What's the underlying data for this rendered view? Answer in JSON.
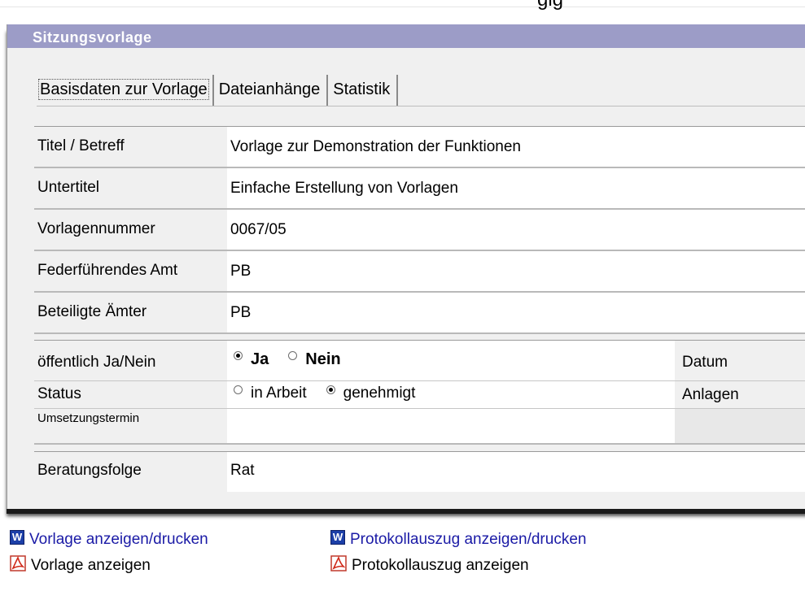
{
  "top_fragment": "gig",
  "panel": {
    "title": "Sitzungsvorlage",
    "tabs": [
      {
        "label": "Basisdaten zur Vorlage",
        "active": true
      },
      {
        "label": "Dateianhänge",
        "active": false
      },
      {
        "label": "Statistik",
        "active": false
      }
    ]
  },
  "form": {
    "rows": [
      {
        "label": "Titel / Betreff",
        "value": "Vorlage zur Demonstration der Funktionen"
      },
      {
        "label": "Untertitel",
        "value": "Einfache Erstellung von Vorlagen"
      },
      {
        "label": "Vorlagennummer",
        "value": "0067/05"
      },
      {
        "label": "Federführendes Amt",
        "value": "PB"
      },
      {
        "label": "Beteiligte Ämter",
        "value": "PB"
      }
    ],
    "oeffentlich": {
      "label": "öffentlich Ja/Nein",
      "options": [
        {
          "label": "Ja",
          "checked": true
        },
        {
          "label": "Nein",
          "checked": false
        }
      ],
      "right_label": "Datum"
    },
    "status": {
      "label": "Status",
      "options": [
        {
          "label": "in Arbeit",
          "checked": false
        },
        {
          "label": "genehmigt",
          "checked": true
        }
      ],
      "right_label": "Anlagen"
    },
    "umsetzungstermin": {
      "label": "Umsetzungstermin",
      "value": ""
    },
    "beratungsfolge": {
      "label": "Beratungsfolge",
      "value": "Rat"
    }
  },
  "links": {
    "vorlage_word": "Vorlage anzeigen/drucken",
    "protokoll_word": "Protokollauszug anzeigen/drucken",
    "vorlage_pdf": "Vorlage anzeigen",
    "protokoll_pdf": "Protokollauszug anzeigen"
  },
  "icons": {
    "word": "word-document-icon",
    "pdf": "pdf-document-icon"
  },
  "colors": {
    "header_bar": "#9c9cc7",
    "panel_bg": "#f0f0f0",
    "link_blue": "#1a1aa6"
  }
}
